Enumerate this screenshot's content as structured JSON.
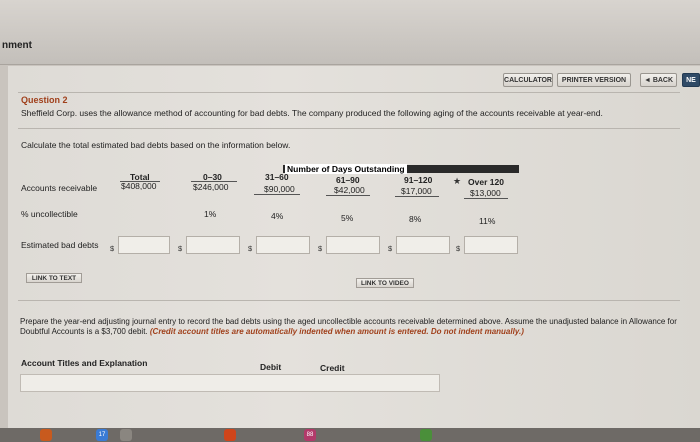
{
  "window": {
    "title_fragment": "nment"
  },
  "nav": {
    "calculator": "CALCULATOR",
    "printer_version": "PRINTER VERSION",
    "back": "◄ BACK",
    "next": "NE"
  },
  "question": {
    "title": "Question 2",
    "text": "Sheffield Corp. uses the allowance method of accounting for bad debts. The company produced the following aging of the accounts receivable at year-end.",
    "instruction": "Calculate the total estimated bad debts based on the information below."
  },
  "aging_table": {
    "group_header": "Number of Days Outstanding",
    "columns": [
      "Total",
      "0–30",
      "31–60",
      "61–90",
      "91–120",
      "Over 120"
    ],
    "rows": [
      {
        "label": "Accounts receivable",
        "values": [
          "$408,000",
          "$246,000",
          "$90,000",
          "$42,000",
          "$17,000",
          "$13,000"
        ]
      },
      {
        "label": "% uncollectible",
        "values": [
          "",
          "1%",
          "4%",
          "5%",
          "8%",
          "11%"
        ]
      },
      {
        "label": "Estimated bad debts",
        "values": [
          "$",
          "$",
          "$",
          "$",
          "$",
          "$"
        ]
      }
    ]
  },
  "links": {
    "link_to_text": "LINK TO TEXT",
    "link_to_video": "LINK TO VIDEO"
  },
  "journal": {
    "prompt": "Prepare the year-end adjusting journal entry to record the bad debts using the aged uncollectible accounts receivable determined above. Assume the unadjusted balance in Allowance for Doubtful Accounts is a $3,700 debit.",
    "prompt_note": "(Credit account titles are automatically indented when amount is entered. Do not indent manually.)",
    "headers": {
      "account": "Account Titles and Explanation",
      "debit": "Debit",
      "credit": "Credit"
    }
  },
  "taskbar": {
    "badge": "17",
    "badge2": "88"
  },
  "colors": {
    "accent": "#a0401b",
    "table_header": "#2a2a2a",
    "background": "#dedbd6"
  }
}
